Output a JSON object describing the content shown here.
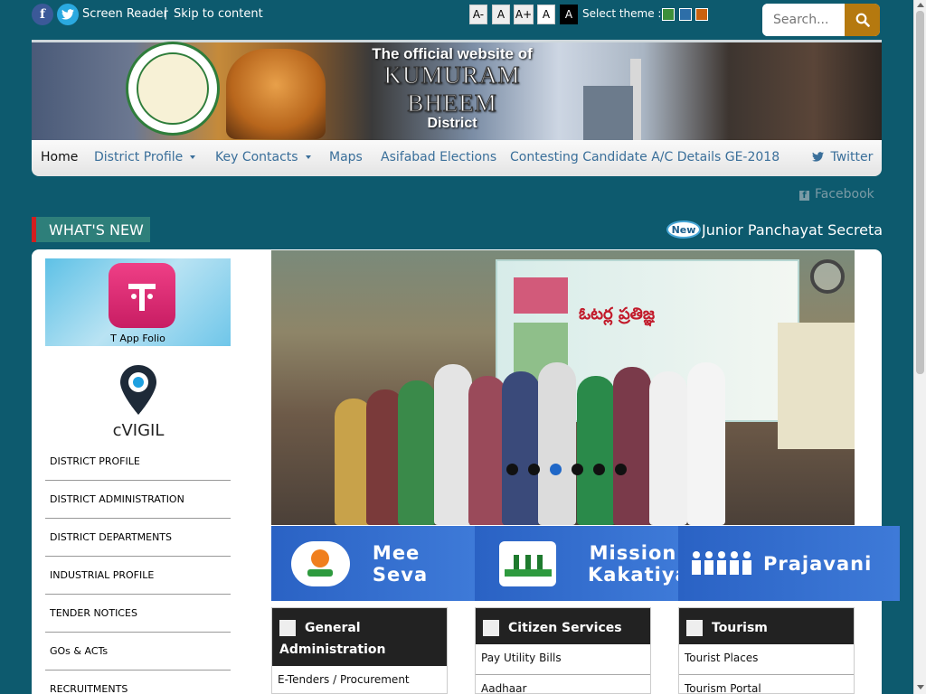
{
  "topbar": {
    "facebook_icon": "facebook-icon",
    "twitter_icon": "twitter-icon",
    "screen_reader": "Screen Reader",
    "separator": "|",
    "skip_to_content": "Skip to content",
    "font_sizes": [
      "A-",
      "A",
      "A+",
      "A",
      "A"
    ],
    "theme_label": "Select theme :",
    "theme_colors": [
      "#3c8f3a",
      "#2d6ea8",
      "#c9610f"
    ],
    "search_placeholder": "Search...",
    "search_icon": "search-icon"
  },
  "banner": {
    "line1": "The official website of",
    "line2": "KUMURAM BHEEM",
    "line3": "District"
  },
  "nav": {
    "items": [
      {
        "label": "Home"
      },
      {
        "label": "District Profile"
      },
      {
        "label": "Key Contacts"
      },
      {
        "label": "Maps"
      },
      {
        "label": "Asifabad Elections"
      },
      {
        "label": "Contesting Candidate A/C Details GE-2018"
      }
    ],
    "twitter": "Twitter",
    "facebook": "Facebook"
  },
  "whats_new": {
    "title": "WHAT'S NEW",
    "badge": "New",
    "ticker": "Junior Panchayat Secretari"
  },
  "sidebar": {
    "tapp_caption": "T App Folio",
    "cvigil_caption": "cVIGIL",
    "menu": [
      "DISTRICT PROFILE",
      "DISTRICT ADMINISTRATION",
      "DISTRICT DEPARTMENTS",
      "INDUSTRIAL PROFILE",
      "TENDER NOTICES",
      "GOs & ACTs",
      "RECRUITMENTS"
    ]
  },
  "slider": {
    "heading": "ఓటర్ల ప్రతిజ్ఞ",
    "dots": 6,
    "active_dot": 3
  },
  "tiles": [
    {
      "label": "Mee Seva"
    },
    {
      "label": "Mission Kakatiya"
    },
    {
      "label": "Prajavani"
    }
  ],
  "cards": [
    {
      "title": "General Administration",
      "items": [
        "E-Tenders / Procurement"
      ]
    },
    {
      "title": "Citizen Services",
      "items": [
        "Pay Utility Bills",
        "Aadhaar"
      ]
    },
    {
      "title": "Tourism",
      "items": [
        "Tourist Places",
        "Tourism Portal"
      ]
    }
  ]
}
